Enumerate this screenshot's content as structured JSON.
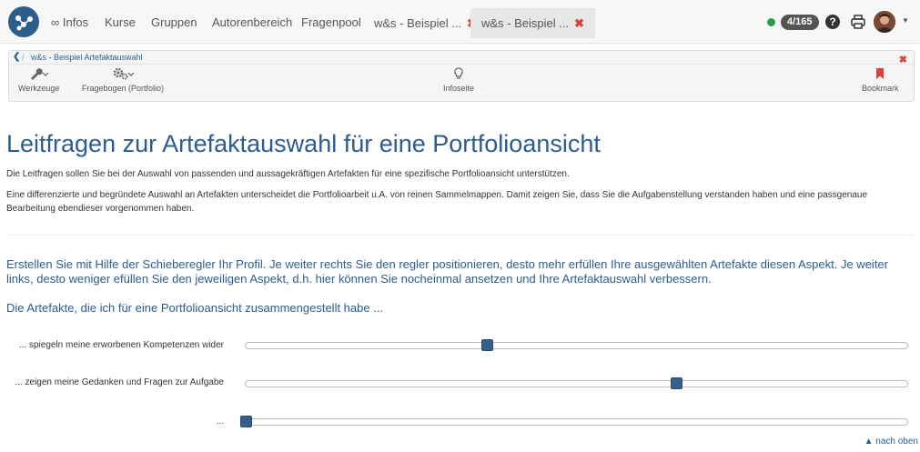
{
  "nav": {
    "items": [
      "∞ Infos",
      "Kurse",
      "Gruppen",
      "Autorenbereich",
      "Fragenpool"
    ],
    "tabs": [
      {
        "label": "w&s - Beispiel ...",
        "close": "✖"
      },
      {
        "label": "w&s - Beispiel ...",
        "close": "✖"
      }
    ],
    "counter": "4/165",
    "help": "?",
    "status_color": "#2b9c4a"
  },
  "toolbar": {
    "back": "❮",
    "separator": "/",
    "breadcrumb": "w&s - Beispiel Artefaktauswahl",
    "close": "✖",
    "tools": [
      {
        "icon": "wrench-icon",
        "label": "Werkzeuge"
      },
      {
        "icon": "gears-icon",
        "label": "Fragebogen (Portfolio)"
      },
      {
        "icon": "lightbulb-icon",
        "label": "Infoseite"
      },
      {
        "icon": "bookmark-icon",
        "label": "Bookmark"
      }
    ]
  },
  "content": {
    "title": "Leitfragen zur Artefaktauswahl für eine Portfolioansicht",
    "intro1": "Die Leitfragen sollen Sie bei der Auswahl von passenden und aussagekräftigen Artefakten für eine spezifische Portfolioansicht unterstützen.",
    "intro2": "Eine differenzierte und begründete Auswahl an Artefakten unterscheidet die Portfolioarbeit u.A. von reinen Sammelmappen. Damit zeigen Sie, dass Sie die Aufgabenstellung verstanden haben und eine passgenaue Bearbeitung ebendieser vorgenommen haben.",
    "lead": "Erstellen Sie mit Hilfe der Schieberegler Ihr Profil. Je weiter rechts Sie den regler positionieren, desto mehr erfüllen Ihre ausgewählten Artefakte diesen Aspekt. Je weiter links, desto weniger efüllen Sie den jeweiligen Aspekt, d.h. hier können Sie nocheinmal ansetzen und Ihre Artefaktauswahl verbessern.",
    "subhead": "Die Artefakte, die ich für eine Portfolioansicht zusammengestellt habe ...",
    "sliders": [
      {
        "label": "... spiegeln meine erworbenen Kompetenzen wider",
        "value": 0.365
      },
      {
        "label": "... zeigen meine Gedanken und Fragen zur Aufgabe",
        "value": 0.65
      },
      {
        "label": "...",
        "value": 0.0
      }
    ],
    "back_to_top": "▲ nach oben"
  },
  "colors": {
    "accent": "#2c5d8f",
    "handle": "#355e8d",
    "close": "#d9413a"
  }
}
